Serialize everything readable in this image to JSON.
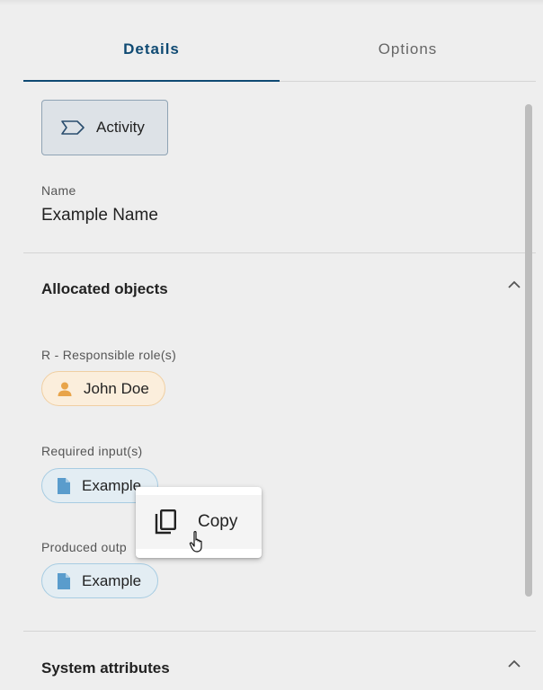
{
  "tabs": [
    {
      "label": "Details",
      "active": true
    },
    {
      "label": "Options",
      "active": false
    }
  ],
  "type_chip": {
    "label": "Activity",
    "icon": "activity-pentagon-icon"
  },
  "name_field": {
    "label": "Name",
    "value": "Example Name"
  },
  "allocated_objects": {
    "title": "Allocated objects",
    "expanded": true,
    "responsible": {
      "label": "R - Responsible role(s)",
      "chips": [
        {
          "label": "John Doe",
          "icon": "person-icon"
        }
      ]
    },
    "required_input": {
      "label": "Required input(s)",
      "chips": [
        {
          "label": "Example",
          "icon": "document-icon"
        }
      ]
    },
    "produced_output": {
      "label": "Produced outp",
      "chips": [
        {
          "label": "Example",
          "icon": "document-icon"
        }
      ]
    }
  },
  "system_attributes": {
    "title": "System attributes",
    "expanded": true
  },
  "context_menu": {
    "items": [
      {
        "label": "Copy",
        "icon": "copy-icon"
      }
    ]
  },
  "colors": {
    "accent": "#0f4a73",
    "person_chip_bg": "#fbeedc",
    "person_icon": "#e8a44a",
    "doc_chip_bg": "#e3edf3",
    "doc_icon": "#5a9ccc"
  }
}
